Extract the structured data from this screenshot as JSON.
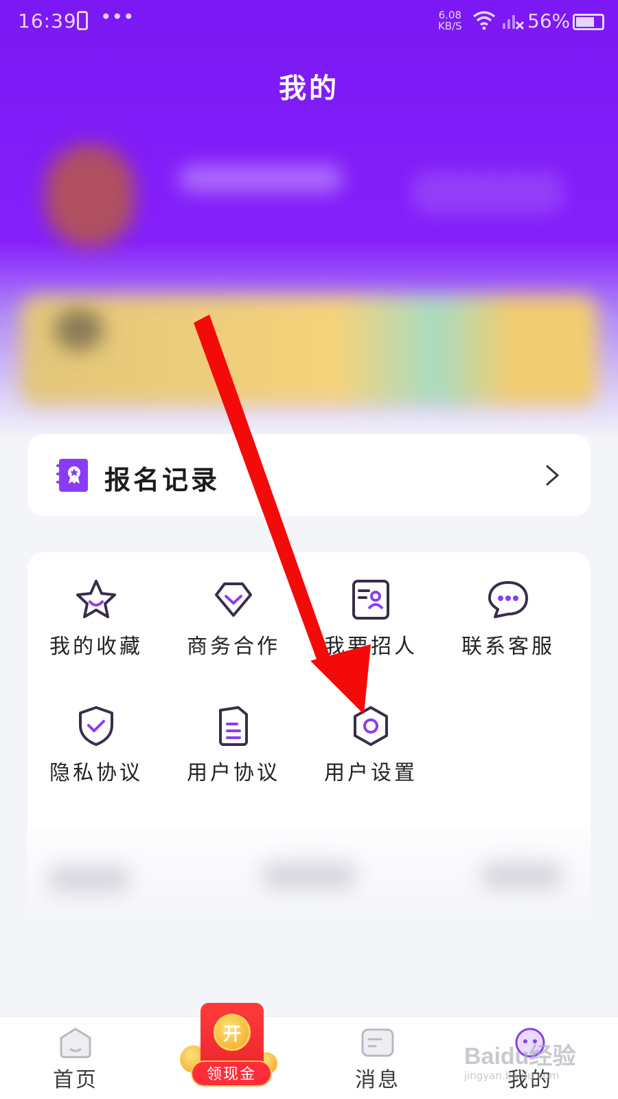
{
  "status_bar": {
    "time": "16:39",
    "dots": "•••",
    "speed_value": "6.08",
    "speed_unit": "KB/S",
    "battery": "56%"
  },
  "header": {
    "title": "我的"
  },
  "record_card": {
    "label": "报名记录",
    "icon": "certificate-book-icon"
  },
  "menu_grid": {
    "items": [
      {
        "label": "我的收藏",
        "icon": "star-icon"
      },
      {
        "label": "商务合作",
        "icon": "diamond-icon"
      },
      {
        "label": "我要招人",
        "icon": "id-card-icon"
      },
      {
        "label": "联系客服",
        "icon": "chat-bubble-icon"
      },
      {
        "label": "隐私协议",
        "icon": "shield-check-icon"
      },
      {
        "label": "用户协议",
        "icon": "document-icon"
      },
      {
        "label": "用户设置",
        "icon": "hexagon-settings-icon"
      }
    ]
  },
  "tab_bar": {
    "tabs": [
      {
        "label": "首页",
        "icon": "home-icon"
      },
      {
        "label": "消息",
        "icon": "message-icon"
      },
      {
        "label": "我的",
        "icon": "profile-icon",
        "active": true
      }
    ],
    "cash_button": {
      "coin_text": "开",
      "label": "领现金"
    }
  },
  "watermark": {
    "line1": "Baidu经验",
    "line2": "jingyan.baidu.com"
  },
  "colors": {
    "accent_purple": "#7b18f3",
    "icon_purple": "#8a3cf5",
    "arrow_red": "#f50a0a"
  }
}
